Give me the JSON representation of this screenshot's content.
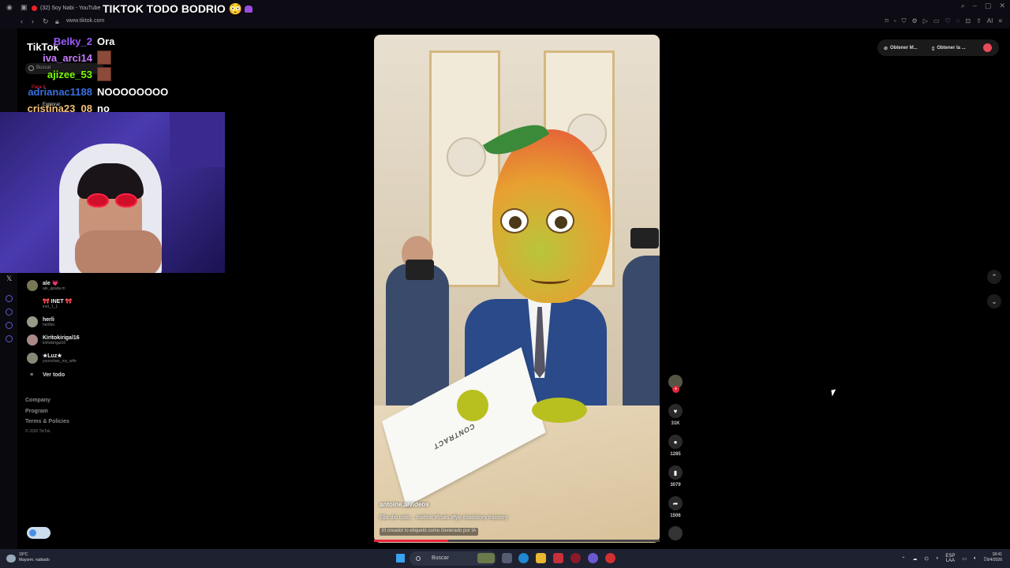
{
  "browser": {
    "tab_title": "(32) Soy Nabi - YouTube",
    "url": "www.tiktok.com"
  },
  "stream": {
    "title": "TIKTOK TODO BODRIO 😳"
  },
  "tiktok": {
    "logo": "TikTok",
    "search_placeholder": "Buscar",
    "menu": [
      "Para ti",
      "Explorar"
    ],
    "following_accounts": [
      {
        "name": "ale 💗",
        "handle": "ale_apaita.m"
      },
      {
        "name": "🎀 INET 🎀",
        "handle": "inet_1_1"
      },
      {
        "name": "herli",
        "handle": "herlibo"
      },
      {
        "name": "Kiritokirigal16",
        "handle": "kiritokirigal16"
      },
      {
        "name": "★Luz★",
        "handle": "yoonchan_my_wife"
      }
    ],
    "see_all": "Ver todo",
    "footer_links": [
      "Company",
      "Program",
      "Terms & Policies"
    ],
    "copyright": "© 2026 TikTok",
    "get_buttons": [
      "Obtener M...",
      "Obtener la ..."
    ]
  },
  "chat": [
    {
      "user": "Belky_2",
      "color": "#9b59ff",
      "message": "Ora"
    },
    {
      "user": "iva_arci14",
      "color": "#c77dff",
      "message": "",
      "emote": true
    },
    {
      "user": "ajizee_53",
      "color": "#7cfc00",
      "message": "",
      "emote": true
    },
    {
      "user": "adrianac1188",
      "color": "#3a6fe0",
      "message": "NOOOOOOOO"
    },
    {
      "user": "cristina23_08",
      "color": "#f4c27a",
      "message": "no"
    }
  ],
  "video": {
    "username": "antoine.aivideos",
    "caption": "Ella dio todo... #aifruit #fruits #fyp #sadstory #aistory",
    "ai_label": "El creador lo etiquetó como Generado por IA",
    "paper_text": "CONTRACT",
    "progress": 0.26,
    "likes": "31K",
    "comments": "1285",
    "saves": "3079",
    "shares": "1506"
  },
  "taskbar": {
    "weather_temp": "19°C",
    "weather_desc": "Mayorm. nublado",
    "search": "Buscar",
    "lang_top": "ESP",
    "lang_bottom": "LAA",
    "time": "18:41",
    "date": "9/4/2026"
  }
}
